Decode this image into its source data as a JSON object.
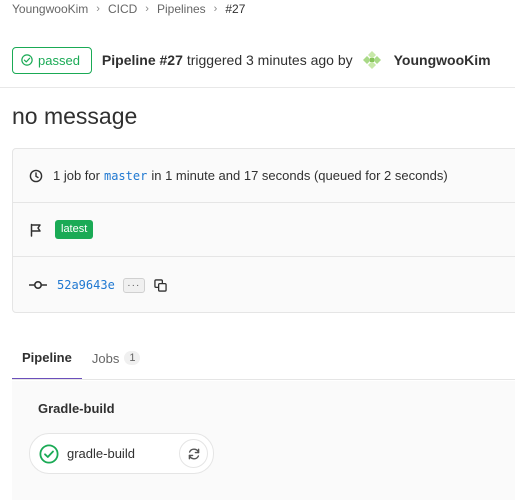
{
  "breadcrumb": {
    "items": [
      "YoungwooKim",
      "CICD",
      "Pipelines",
      "#27"
    ],
    "separator": "›"
  },
  "header": {
    "status_label": "passed",
    "pipeline_label": "Pipeline #27",
    "triggered_text": "triggered 3 minutes ago by",
    "user_name": "YoungwooKim"
  },
  "title": "no message",
  "info": {
    "jobs_prefix": "1 job for",
    "branch": "master",
    "duration_text": "in 1 minute and 17 seconds (queued for 2 seconds)",
    "tag_label": "latest",
    "commit_sha": "52a9643e",
    "ellipsis_label": "···"
  },
  "tabs": [
    {
      "label": "Pipeline",
      "active": true
    },
    {
      "label": "Jobs",
      "count": "1",
      "active": false
    }
  ],
  "graph": {
    "stage_name": "Gradle-build",
    "job_name": "gradle-build"
  },
  "colors": {
    "success": "#1aaa55",
    "link": "#1f78d1",
    "tab_active": "#6b4fbb"
  },
  "icons": {
    "status": "check-circle-icon",
    "clock": "clock-icon",
    "flag": "flag-icon",
    "commit": "commit-icon",
    "copy": "copy-icon",
    "retry": "retry-icon"
  }
}
